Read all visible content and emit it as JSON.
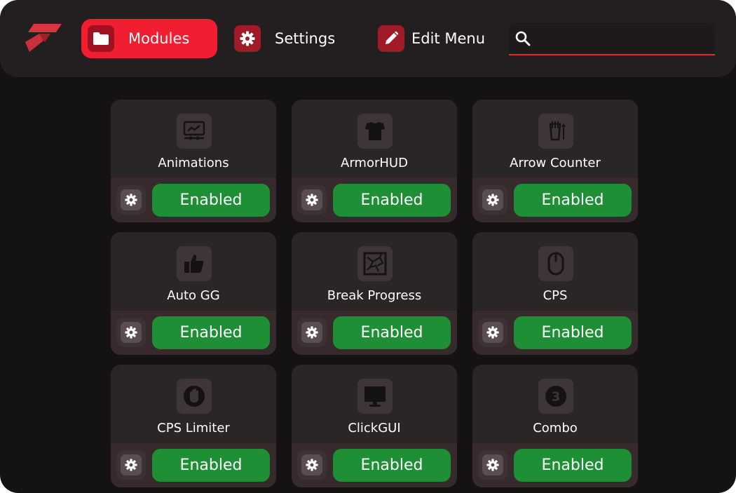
{
  "nav": {
    "modules_label": "Modules",
    "settings_label": "Settings",
    "edit_menu_label": "Edit Menu"
  },
  "search": {
    "value": "",
    "placeholder": ""
  },
  "colors": {
    "accent": "#f01e30",
    "enabled": "#1e8f35",
    "background": "#151213",
    "card": "#2a2627"
  },
  "modules": [
    {
      "name": "Animations",
      "status": "Enabled",
      "icon": "animations-icon"
    },
    {
      "name": "ArmorHUD",
      "status": "Enabled",
      "icon": "armor-icon"
    },
    {
      "name": "Arrow Counter",
      "status": "Enabled",
      "icon": "arrow-quiver-icon"
    },
    {
      "name": "Auto GG",
      "status": "Enabled",
      "icon": "thumbs-up-icon"
    },
    {
      "name": "Break Progress",
      "status": "Enabled",
      "icon": "cracked-block-icon"
    },
    {
      "name": "CPS",
      "status": "Enabled",
      "icon": "mouse-icon"
    },
    {
      "name": "CPS Limiter",
      "status": "Enabled",
      "icon": "hand-stop-icon"
    },
    {
      "name": "ClickGUI",
      "status": "Enabled",
      "icon": "monitor-icon"
    },
    {
      "name": "Combo",
      "status": "Enabled",
      "icon": "number-three-icon",
      "icon_text": "3"
    }
  ]
}
